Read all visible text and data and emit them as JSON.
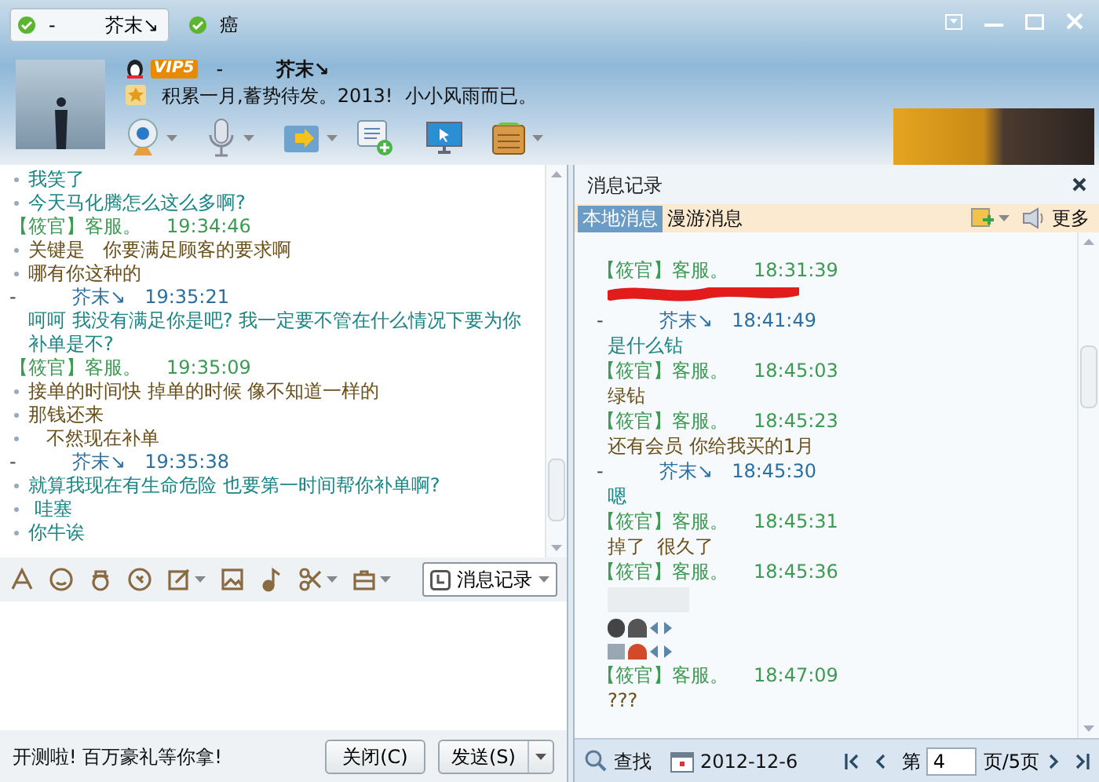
{
  "tabs": [
    {
      "label": "芥末↘",
      "prefix": "-",
      "selected": true
    },
    {
      "label": "癌",
      "selected": false
    }
  ],
  "profile": {
    "badge": "VIP5",
    "dash": "-",
    "name": "芥末↘",
    "signature": "积累一月,蓄势待发。2013!  小小风雨而已。"
  },
  "chat": [
    {
      "kind": "self_line",
      "bulleted": true,
      "text": "我笑了"
    },
    {
      "kind": "self_line",
      "bulleted": true,
      "text": "今天马化腾怎么这么多啊?"
    },
    {
      "kind": "other_header",
      "sender": "【筱官】客服。",
      "time": "19:34:46"
    },
    {
      "kind": "other_line",
      "bulleted": true,
      "text": "关键是   你要满足顾客的要求啊"
    },
    {
      "kind": "other_line",
      "bulleted": true,
      "text": "哪有你这种的"
    },
    {
      "kind": "self_header",
      "dash": "-",
      "sender": "芥末↘",
      "time": "19:35:21"
    },
    {
      "kind": "self_line",
      "bulleted": false,
      "text": "呵呵 我没有满足你是吧? 我一定要不管在什么情况下要为你补单是不?"
    },
    {
      "kind": "other_header",
      "sender": "【筱官】客服。",
      "time": "19:35:09"
    },
    {
      "kind": "other_line",
      "bulleted": true,
      "text": "接单的时间快 掉单的时候 像不知道一样的"
    },
    {
      "kind": "other_line",
      "bulleted": true,
      "text": "那钱还来"
    },
    {
      "kind": "other_line",
      "bulleted": true,
      "text": "   不然现在补单"
    },
    {
      "kind": "self_header",
      "dash": "-",
      "sender": "芥末↘",
      "time": "19:35:38"
    },
    {
      "kind": "self_line",
      "bulleted": true,
      "text": "就算我现在有生命危险 也要第一时间帮你补单啊?"
    },
    {
      "kind": "self_line",
      "bulleted": true,
      "text": " 哇塞"
    },
    {
      "kind": "self_line",
      "bulleted": true,
      "text": "你牛诶"
    }
  ],
  "history_button": "消息记录",
  "footer": {
    "ad": "开测啦! 百万豪礼等你拿!",
    "close": "关闭(C)",
    "send": "发送(S)"
  },
  "history": {
    "title": "消息记录",
    "tabs": [
      {
        "label": "本地消息",
        "selected": true
      },
      {
        "label": "漫游消息",
        "selected": false
      }
    ],
    "more": "更多",
    "entries": [
      {
        "kind": "other_header",
        "sender": "【筱官】客服。",
        "time": "18:31:39"
      },
      {
        "kind": "redacted"
      },
      {
        "kind": "self_header",
        "dash": "-",
        "sender": "芥末↘",
        "time": "18:41:49"
      },
      {
        "kind": "self_line",
        "text": "是什么钻"
      },
      {
        "kind": "other_header",
        "sender": "【筱官】客服。",
        "time": "18:45:03"
      },
      {
        "kind": "other_line",
        "text": "绿钻"
      },
      {
        "kind": "other_header",
        "sender": "【筱官】客服。",
        "time": "18:45:23"
      },
      {
        "kind": "other_line",
        "text": "还有会员 你给我买的1月"
      },
      {
        "kind": "self_header",
        "dash": "-",
        "sender": "芥末↘",
        "time": "18:45:30"
      },
      {
        "kind": "self_line",
        "text": "嗯"
      },
      {
        "kind": "other_header",
        "sender": "【筱官】客服。",
        "time": "18:45:31"
      },
      {
        "kind": "other_line",
        "text": "掉了  很久了"
      },
      {
        "kind": "other_header",
        "sender": "【筱官】客服。",
        "time": "18:45:36"
      },
      {
        "kind": "stickers"
      },
      {
        "kind": "other_header",
        "sender": "【筱官】客服。",
        "time": "18:47:09"
      },
      {
        "kind": "other_line",
        "text": "???"
      }
    ],
    "search": "查找",
    "date": "2012-12-6",
    "page_prefix": "第",
    "page": "4",
    "page_suffix": "页/5页"
  }
}
